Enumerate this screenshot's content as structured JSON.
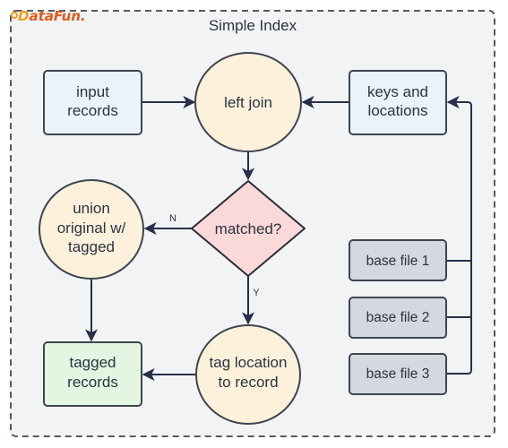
{
  "logo": {
    "text_prefix": "D",
    "text_rest": "ataFun.",
    "color_primary": "#f0a020",
    "color_secondary": "#e05a1a"
  },
  "container": {
    "title": "Simple Index",
    "background": "#f2f3f5",
    "border_color": "#555a60"
  },
  "colors": {
    "process_fill": "#fdf1dc",
    "data_fill": "#eaf2fc",
    "output_fill": "#e3f6e1",
    "decision_fill": "#fbd9d9",
    "base_fill": "#d5d9df",
    "stroke": "#3d4650",
    "edge": "#27304a"
  },
  "nodes": {
    "input_records": {
      "lines": [
        "input",
        "records"
      ]
    },
    "left_join": {
      "lines": [
        "left join"
      ]
    },
    "keys_and_locations": {
      "lines": [
        "keys and",
        "locations"
      ]
    },
    "matched": {
      "lines": [
        "matched?"
      ]
    },
    "union": {
      "lines": [
        "union",
        "original w/",
        "tagged"
      ]
    },
    "tagged_records": {
      "lines": [
        "tagged",
        "records"
      ]
    },
    "tag_location": {
      "lines": [
        "tag location",
        "to record"
      ]
    },
    "base_files": [
      "base file 1",
      "base file 2",
      "base file 3"
    ]
  },
  "edges": {
    "no_label": "N",
    "yes_label": "Y"
  }
}
